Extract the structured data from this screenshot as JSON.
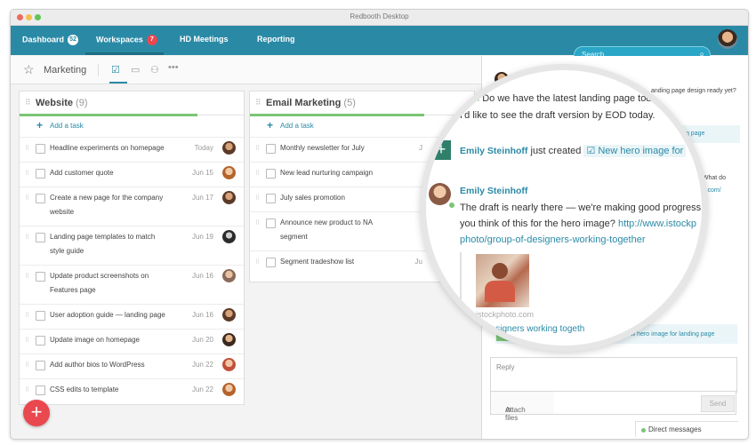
{
  "window": {
    "title": "Redbooth Desktop"
  },
  "nav": {
    "dashboard": {
      "label": "Dashboard",
      "badge": "52"
    },
    "workspaces": {
      "label": "Workspaces",
      "badge": "7"
    },
    "hd_meetings": {
      "label": "HD Meetings"
    },
    "reporting": {
      "label": "Reporting"
    },
    "search_placeholder": "Search"
  },
  "workspace": {
    "name": "Marketing"
  },
  "columns": [
    {
      "title": "Website",
      "count": "(9)",
      "add_task": "Add a task",
      "progress": 0.74,
      "tasks": [
        {
          "title": "Headline experiments on homepage",
          "date": "Today"
        },
        {
          "title": "Add customer quote",
          "date": "Jun 15"
        },
        {
          "title": "Create a new page for the company website",
          "date": "Jun 17"
        },
        {
          "title": "Landing page templates to match style guide",
          "date": "Jun 19"
        },
        {
          "title": "Update product screenshots on Features page",
          "date": "Jun 16"
        },
        {
          "title": "User adoption guide — landing page",
          "date": "Jun 16"
        },
        {
          "title": "Update image on homepage",
          "date": "Jun 20"
        },
        {
          "title": "Add author bios to WordPress",
          "date": "Jun 22"
        },
        {
          "title": "CSS edits to template",
          "date": "Jun 22"
        }
      ]
    },
    {
      "title": "Email Marketing",
      "count": "(5)",
      "add_task": "Add a task",
      "progress": 0.72,
      "tasks": [
        {
          "title": "Monthly newsletter for July",
          "date": "J"
        },
        {
          "title": "New lead nurturing campaign",
          "date": ""
        },
        {
          "title": "July sales promotion",
          "date": ""
        },
        {
          "title": "Announce new product to NA segment",
          "date": ""
        },
        {
          "title": "Segment tradeshow list",
          "date": "Ju"
        }
      ]
    }
  ],
  "activity": {
    "top_line": "anding page design ready yet?",
    "tag_landing": "re for landing page",
    "top_right_frag1": "ss! What do",
    "top_right_frag2": "photo.com/",
    "resolved_text": "olved",
    "resolved_tag": "New hero image for landing page"
  },
  "magnifier": {
    "line1_mention": "@all",
    "line1_text": "Do we have the latest landing page today.",
    "line2_text": "I'd like to see the draft version by EOD today.",
    "event_user": "Emily Steinhoff",
    "event_text": "just created",
    "event_tag": "New hero image for",
    "comment_user": "Emily Steinhoff",
    "comment_line1": "The draft is nearly there — we're making good progress.",
    "comment_line2_a": "you think of this for the hero image?",
    "comment_line2_link": "http://www.istockp",
    "comment_line3_link": "photo/group-of-designers-working-together",
    "image_caption": "istockphoto.com",
    "image_title": "of designers working togeth"
  },
  "reply": {
    "placeholder": "Reply",
    "attach_label": "Attach files",
    "send_label": "Send"
  },
  "direct_messages": "Direct messages",
  "colors": {
    "nav": "#2a8aa6",
    "badge_red": "#e9484f",
    "green": "#7cc576"
  }
}
